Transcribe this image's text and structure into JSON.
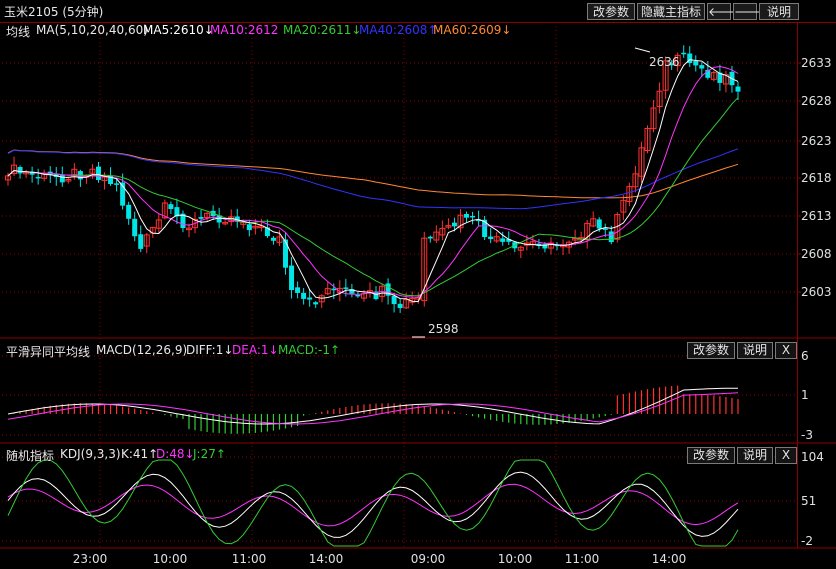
{
  "window": {
    "title": "玉米2105 (5分钟)",
    "buttons": {
      "change_params": "改参数",
      "hide_main_indicator": "隐藏主指标",
      "prev_arrow": "🡐",
      "next_arrow": "🡒",
      "explain": "说明"
    }
  },
  "main_panel": {
    "indicator_name": "均线",
    "params": "MA(5,10,20,40,60)",
    "ma5": "MA5:2610↓",
    "ma10": "MA10:2612",
    "ma20": "MA20:2611↓",
    "ma40": "MA40:2608↑",
    "ma60": "MA60:2609↓",
    "y_ticks": [
      "2633",
      "2628",
      "2623",
      "2618",
      "2613",
      "2608",
      "2603"
    ],
    "high_label": "2636",
    "low_label": "2598"
  },
  "macd_panel": {
    "indicator_name": "平滑异同平均线",
    "params": "MACD(12,26,9)",
    "diff": "DIFF:1↓",
    "dea": "DEA:1↓",
    "macd": "MACD:-1↑",
    "y_ticks": [
      "6",
      "1",
      "-3"
    ],
    "buttons": {
      "change_params": "改参数",
      "explain": "说明",
      "close": "X"
    }
  },
  "kdj_panel": {
    "indicator_name": "随机指标",
    "params": "KDJ(9,3,3)",
    "k": "K:41↑",
    "d": "D:48↓",
    "j": "J:27↑",
    "y_ticks": [
      "104",
      "51",
      "-2"
    ],
    "buttons": {
      "change_params": "改参数",
      "explain": "说明",
      "close": "X"
    }
  },
  "x_axis": {
    "labels": [
      "23:00",
      "10:00",
      "11:00",
      "14:00",
      "09:00",
      "10:00",
      "11:00",
      "14:00"
    ]
  },
  "colors": {
    "up": "#ff3232",
    "down": "#00e5e5",
    "ma5": "#ffffff",
    "ma10": "#ff33ff",
    "ma20": "#33cc33",
    "ma40": "#3333ff",
    "ma60": "#ff8833",
    "grid": "#8b0000",
    "macd_up": "#ff3232",
    "macd_down": "#33cc33"
  }
}
